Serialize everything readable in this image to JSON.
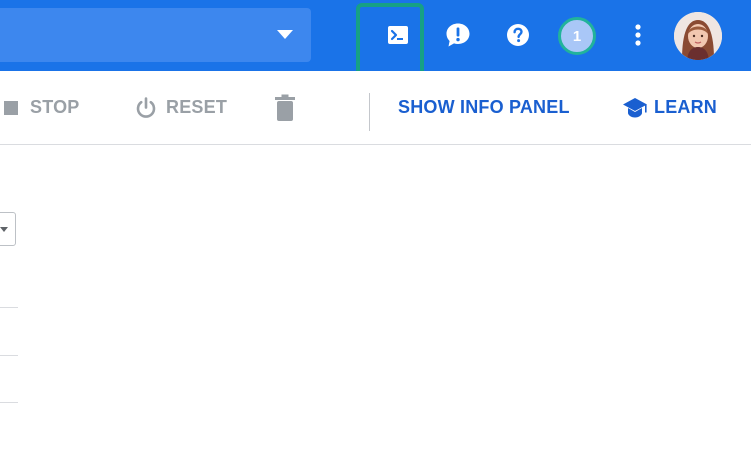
{
  "toolbar": {
    "stop_label": "STOP",
    "reset_label": "RESET",
    "show_info_panel_label": "SHOW INFO PANEL",
    "learn_label": "LEARN"
  },
  "header": {
    "notification_count": "1"
  },
  "colors": {
    "header_bg": "#1a73e8",
    "accent_text": "#1a5fd0",
    "disabled_text": "#9aa0a6",
    "highlight": "#16a085"
  },
  "icons": [
    "chevron-down-icon",
    "cloud-shell-icon",
    "feedback-icon",
    "help-icon",
    "more-vert-icon",
    "stop-icon",
    "power-icon",
    "trash-icon",
    "school-icon"
  ]
}
